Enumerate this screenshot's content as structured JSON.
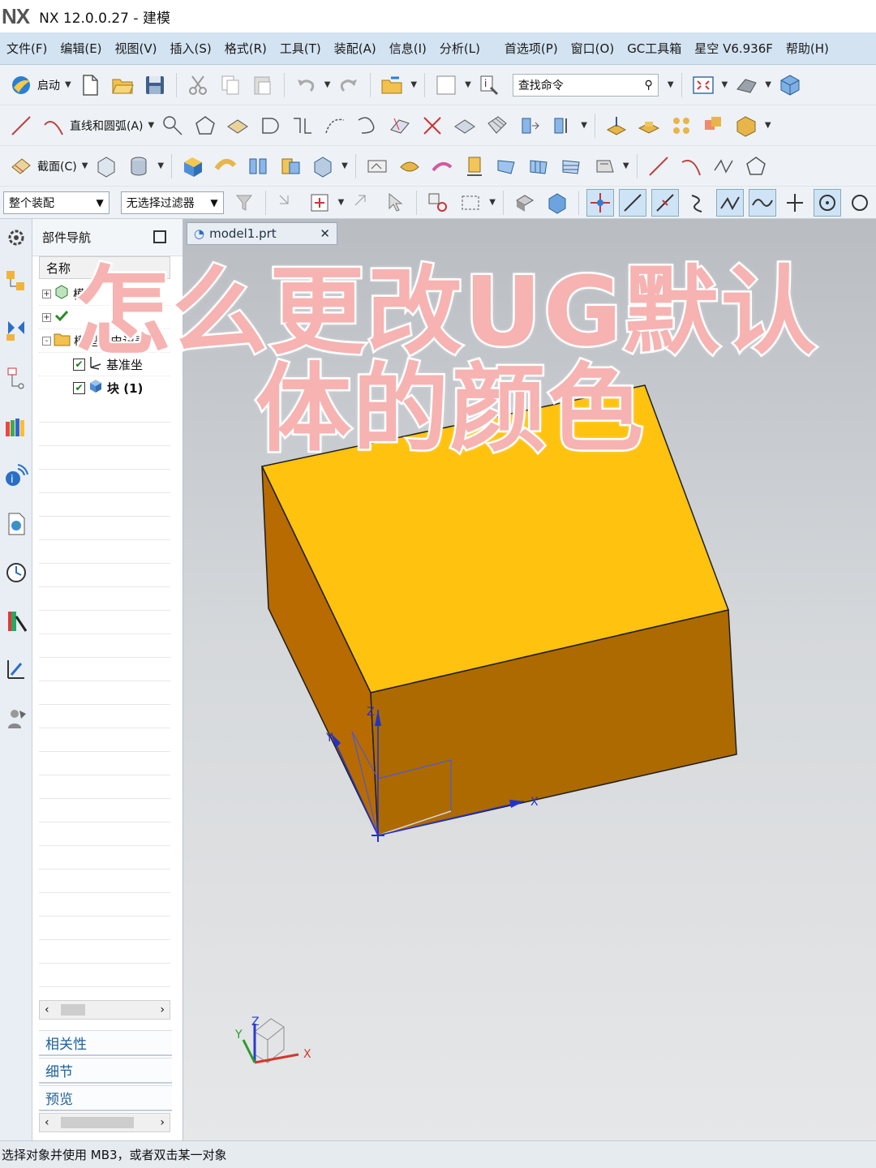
{
  "window": {
    "logo": "NX",
    "title": "NX 12.0.0.27 - 建模"
  },
  "menu": [
    "文件(F)",
    "编辑(E)",
    "视图(V)",
    "插入(S)",
    "格式(R)",
    "工具(T)",
    "装配(A)",
    "信息(I)",
    "分析(L)",
    "首选项(P)",
    "窗口(O)",
    "GC工具箱",
    "星空 V6.936F",
    "帮助(H)"
  ],
  "toolbar1": {
    "start_label": "启动",
    "search_placeholder": "查找命令"
  },
  "toolbar2": {
    "lines_arcs_label": "直线和圆弧(A)"
  },
  "toolbar3": {
    "section_label": "截面(C)"
  },
  "selection": {
    "scope": "整个装配",
    "filter": "无选择过滤器"
  },
  "navigator": {
    "title": "部件导航",
    "column_name": "名称",
    "tree": [
      {
        "label": "模",
        "icon": "model-views-icon",
        "expander": "+"
      },
      {
        "label": "",
        "icon": "camera-check-icon",
        "expander": "+"
      },
      {
        "label": "模型历史记录",
        "icon": "folder-icon",
        "expander": "-"
      },
      {
        "label": "基准坐",
        "icon": "datum-csys-icon",
        "checked": true
      },
      {
        "label": "块 (1)",
        "icon": "block-icon",
        "checked": true
      }
    ],
    "sections": [
      "相关性",
      "细节",
      "预览"
    ]
  },
  "graphics": {
    "tab_label": "model1.prt",
    "body_colors": {
      "top": "#ffc20e",
      "left": "#b86b00",
      "front": "#ad6a00",
      "edge": "#1e1e1e"
    },
    "axis_labels": {
      "x": "X",
      "y": "Y",
      "z": "Z"
    },
    "triad_labels": {
      "x": "X",
      "y": "Y",
      "z": "Z"
    }
  },
  "overlay": {
    "line1": "怎么更改UG默认",
    "line2": "体的颜色"
  },
  "status": "选择对象并使用 MB3，或者双击某一对象"
}
